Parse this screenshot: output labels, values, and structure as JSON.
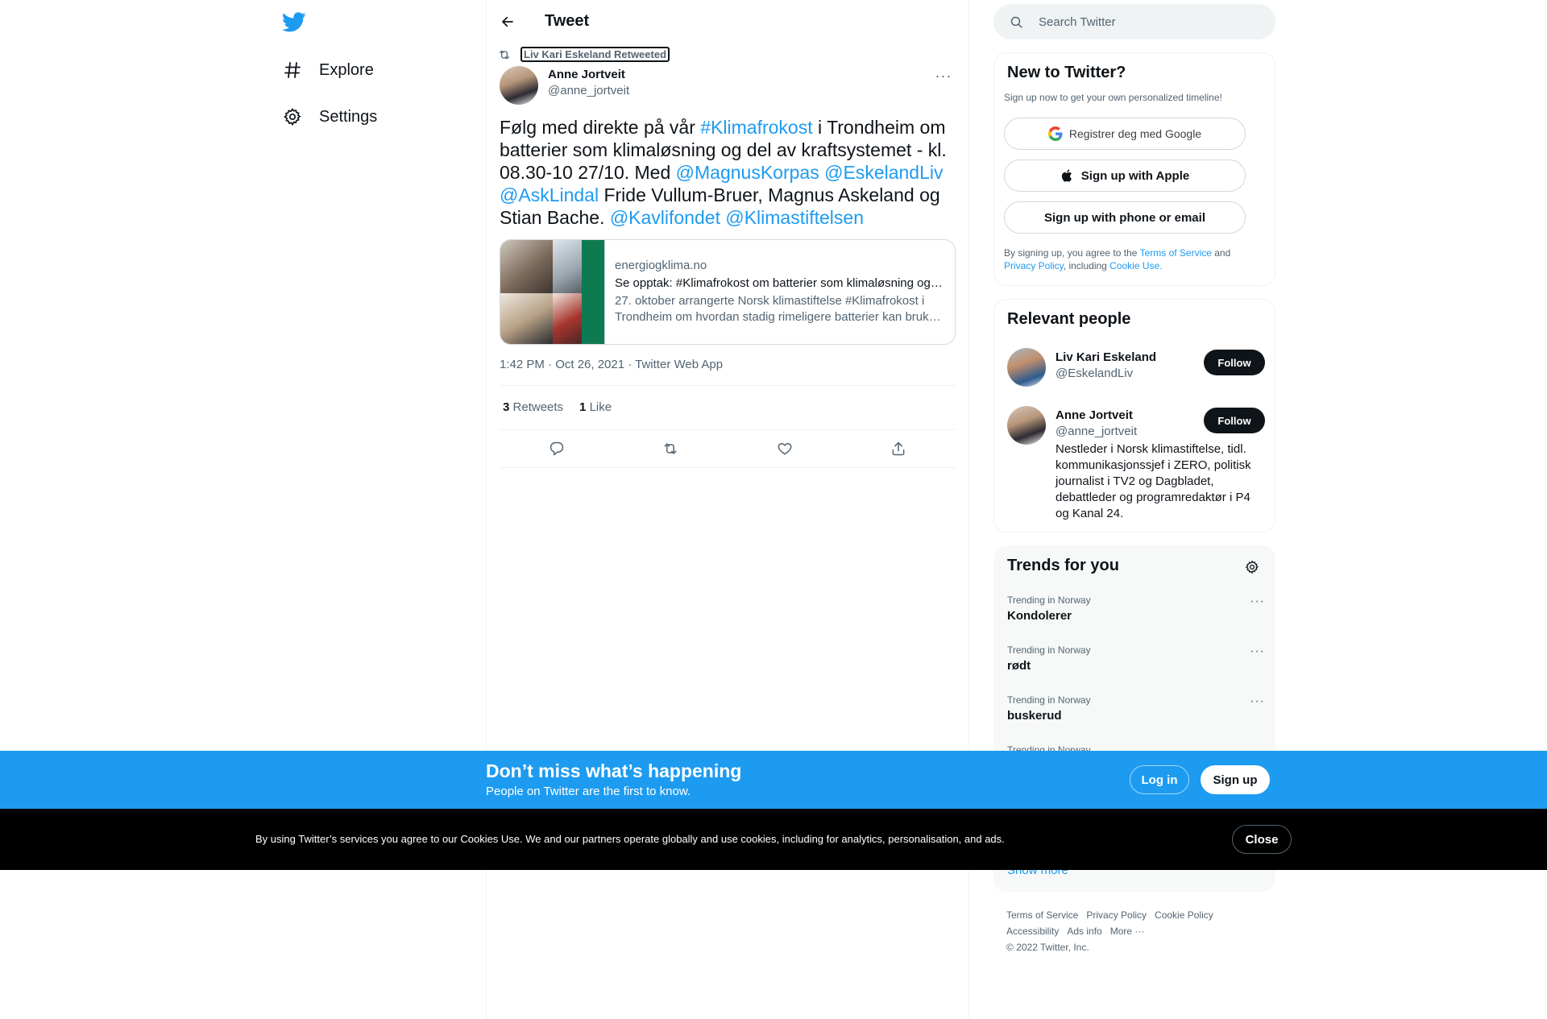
{
  "nav": {
    "logo": "twitter-bird-icon",
    "items": [
      {
        "label": "Explore",
        "icon": "hashtag-icon"
      },
      {
        "label": "Settings",
        "icon": "gear-icon"
      }
    ]
  },
  "header": {
    "title": "Tweet"
  },
  "tweet": {
    "retweeted_by": "Liv Kari Eskeland Retweeted",
    "author_name": "Anne Jortveit",
    "author_handle": "@anne_jortveit",
    "text_parts": {
      "p1": "Følg med direkte på vår ",
      "tag1": "#Klimafrokost",
      "p2": " i Trondheim om batterier som klimaløsning og del av kraftsystemet - kl. 08.30-10 27/10. Med ",
      "m1": "@MagnusKorpas",
      "m2": "@EskelandLiv",
      "m3": "@AskLindal",
      "p3": " Fride Vullum-Bruer, Magnus Askeland og Stian Bache. ",
      "m4": "@Kavlifondet",
      "m5": "@Klimastiftelsen"
    },
    "card": {
      "domain": "energiogklima.no",
      "title": "Se opptak: #Klimafrokost om batterier som klimaløsning og del av kraftsystemet",
      "description": "27. oktober arrangerte Norsk klimastiftelse #Klimafrokost i Trondheim om hvordan stadig rimeligere batterier kan brukes i kraftsystemet."
    },
    "timestamp": "1:42 PM · Oct 26, 2021 · Twitter Web App",
    "stats": {
      "retweets_count": "3",
      "retweets_label": "Retweets",
      "likes_count": "1",
      "likes_label": "Like"
    }
  },
  "sidebar": {
    "search_placeholder": "Search Twitter",
    "new_to_twitter": {
      "title": "New to Twitter?",
      "subtitle": "Sign up now to get your own personalized timeline!",
      "google_button": "Registrer deg med Google",
      "apple_button": "Sign up with Apple",
      "phone_button": "Sign up with phone or email",
      "legal_prefix": "By signing up, you agree to the ",
      "terms": "Terms of Service",
      "and": " and ",
      "privacy": "Privacy Policy",
      "including": ", including ",
      "cookie": "Cookie Use."
    },
    "relevant": {
      "title": "Relevant people",
      "people": [
        {
          "name": "Liv Kari Eskeland",
          "handle": "@EskelandLiv",
          "follow": "Follow"
        },
        {
          "name": "Anne Jortveit",
          "handle": "@anne_jortveit",
          "follow": "Follow",
          "bio": "Nestleder i Norsk klimastiftelse, tidl. kommunikasjonssjef i ZERO, politisk journalist i TV2 og Dagbladet, debattleder og programredaktør i P4 og Kanal 24."
        }
      ]
    },
    "trends": {
      "title": "Trends for you",
      "items": [
        {
          "context": "Trending in Norway",
          "name": "Kondolerer"
        },
        {
          "context": "Trending in Norway",
          "name": "rødt"
        },
        {
          "context": "Trending in Norway",
          "name": "buskerud"
        },
        {
          "context": "Trending in Norway",
          "name": ""
        }
      ],
      "show_more": "Show more"
    },
    "footer": {
      "links": [
        "Terms of Service",
        "Privacy Policy",
        "Cookie Policy",
        "Accessibility",
        "Ads info",
        "More ···"
      ],
      "copyright": "© 2022 Twitter, Inc."
    }
  },
  "signup_bar": {
    "title": "Don’t miss what’s happening",
    "subtitle": "People on Twitter are the first to know.",
    "login": "Log in",
    "signup": "Sign up"
  },
  "cookie_bar": {
    "text": "By using Twitter’s services you agree to our Cookies Use. We and our partners operate globally and use cookies, including for analytics, personalisation, and ads.",
    "close": "Close"
  },
  "colors": {
    "accent": "#1d9bf0",
    "text": "#0f1419",
    "muted": "#536471"
  }
}
